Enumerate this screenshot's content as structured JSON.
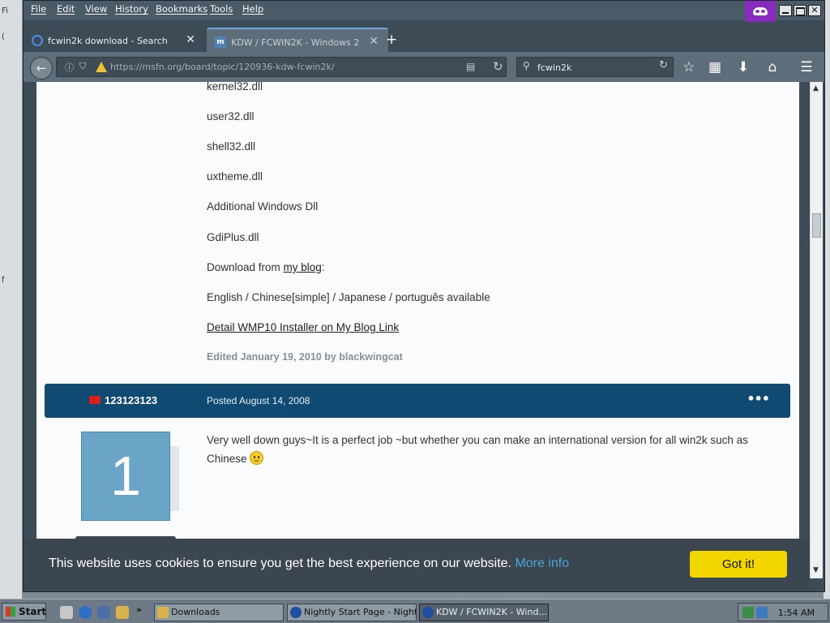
{
  "menubar": {
    "items": [
      "File",
      "Edit",
      "View",
      "History",
      "Bookmarks",
      "Tools",
      "Help"
    ],
    "controls": {
      "close_label": "✕"
    }
  },
  "tabs": [
    {
      "title": "fcwin2k download - Search",
      "favicon": "search-icon",
      "active": false
    },
    {
      "title": "KDW / FCWIN2K - Windows 2...",
      "favicon": "msfn-favicon",
      "active": true
    }
  ],
  "nav": {
    "url": "https://msfn.org/board/topic/120936-kdw-fcwin2k/",
    "search_value": "fcwin2k"
  },
  "post1": {
    "lines": [
      "kernel32.dll",
      "user32.dll",
      "shell32.dll",
      "uxtheme.dll",
      "Additional Windows Dll",
      "GdiPlus.dll"
    ],
    "download_prefix": "Download from ",
    "download_link": "my blog",
    "download_suffix": ":",
    "languages": "English / Chinese[simple] / Japanese / português available",
    "detail_link": "Detail WMP10 Installer on My Blog Link",
    "edited": "Edited January 19, 2010 by blackwingcat"
  },
  "post2": {
    "author": "123123123",
    "date": "Posted August 14, 2008",
    "avatar_letter": "1",
    "avatar_color": "#6aa4c7",
    "body": "Very well down guys~It is a perfect job ~but whether you can make an international version for all win2k such as Chinese",
    "menu_glyph": "•••"
  },
  "cookie": {
    "message": "This website uses cookies to ensure you get the best experience on our website.",
    "more_info": "More info",
    "button": "Got it!"
  },
  "taskbar": {
    "start": "Start",
    "tasks": [
      {
        "label": "Downloads",
        "active": false
      },
      {
        "label": "Nightly Start Page - Nightly",
        "active": false
      },
      {
        "label": "KDW / FCWIN2K - Wind...",
        "active": true
      }
    ],
    "clock": "1:54 AM"
  },
  "colors": {
    "post_header": "#0f4a72",
    "cookie_button": "#f1d600",
    "more_info_link": "#45a6d8",
    "private_badge": "#8a2bbf"
  }
}
